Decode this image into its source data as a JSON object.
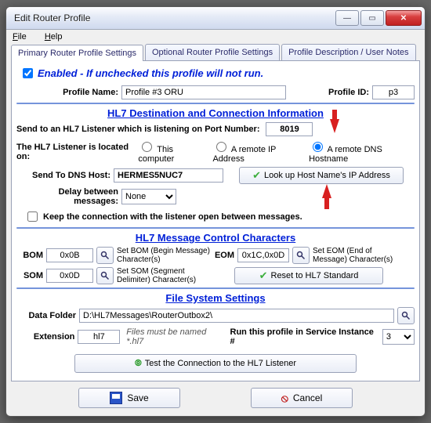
{
  "window": {
    "title": "Edit Router Profile"
  },
  "menu": {
    "file": "File",
    "help": "Help"
  },
  "tabs": {
    "primary": "Primary Router Profile Settings",
    "optional": "Optional Router Profile Settings",
    "desc": "Profile Description / User Notes"
  },
  "enable": {
    "label": "Enabled - If unchecked this profile will not run."
  },
  "profile": {
    "name_label": "Profile Name:",
    "name_value": "Profile #3 ORU",
    "id_label": "Profile ID:",
    "id_value": "p3"
  },
  "dest": {
    "heading": "HL7 Destination and Connection Information",
    "send_port_label": "Send to an HL7 Listener which is listening on Port Number:",
    "port_value": "8019",
    "located_label": "The HL7 Listener is located on:",
    "opt_this": "This computer",
    "opt_remote_ip": "A remote IP Address",
    "opt_remote_dns": "A remote DNS Hostname",
    "dns_label": "Send To DNS Host:",
    "dns_value": "HERMES5NUC7",
    "lookup_btn": "Look up Host Name's IP Address",
    "delay_label": "Delay between messages:",
    "delay_value": "None",
    "keep_label": "Keep the connection with the listener open between messages."
  },
  "mcc": {
    "heading": "HL7 Message Control Characters",
    "bom_label": "BOM",
    "bom_value": "0x0B",
    "bom_btn": "Set BOM (Begin Message) Character(s)",
    "eom_label": "EOM",
    "eom_value": "0x1C,0x0D",
    "eom_btn": "Set EOM (End of Message) Character(s)",
    "som_label": "SOM",
    "som_value": "0x0D",
    "som_btn": "Set SOM (Segment Delimiter) Character(s)",
    "reset_btn": "Reset to HL7 Standard"
  },
  "fs": {
    "heading": "File System Settings",
    "folder_label": "Data Folder",
    "folder_value": "D:\\HL7Messages\\RouterOutbox2\\",
    "ext_label": "Extension",
    "ext_value": "hl7",
    "ext_hint": "Files must be named *.hl7",
    "instance_label": "Run this profile in Service Instance #",
    "instance_value": "3",
    "test_btn": "Test the Connection to the HL7 Listener"
  },
  "buttons": {
    "save": "Save",
    "cancel": "Cancel"
  }
}
